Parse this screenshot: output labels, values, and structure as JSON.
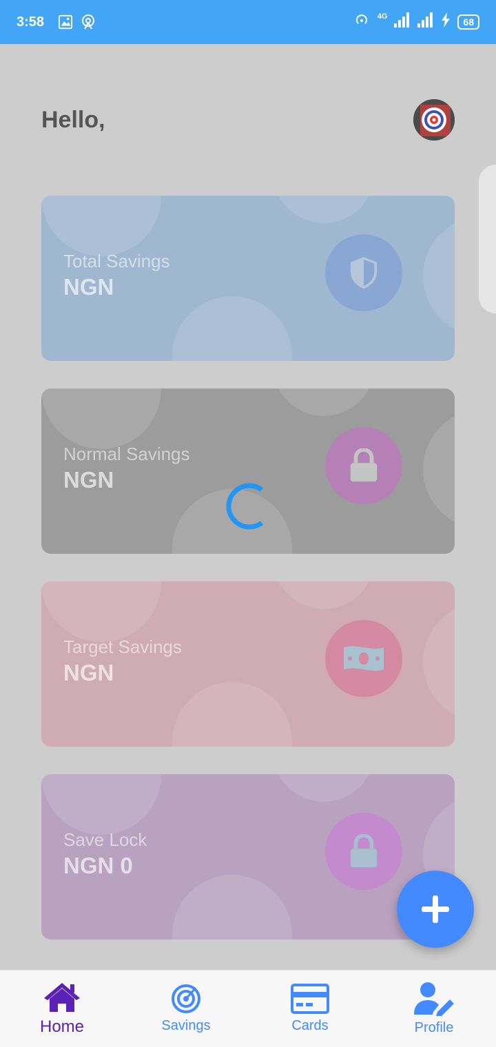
{
  "status_bar": {
    "time": "3:58",
    "network": "4G",
    "battery": "68"
  },
  "header": {
    "greeting": "Hello,"
  },
  "cards": [
    {
      "label": "Total Savings",
      "amount": "NGN",
      "bg": "#a0b8cf",
      "circle": "#8aa7d4",
      "icon": "shield-icon"
    },
    {
      "label": "Normal Savings",
      "amount": "NGN",
      "bg": "#9c9c9c",
      "circle": "#b580b5",
      "icon": "lock-icon"
    },
    {
      "label": "Target Savings",
      "amount": "NGN",
      "bg": "#cfabb6",
      "circle": "#d48aa2",
      "icon": "money-icon"
    },
    {
      "label": "Save Lock",
      "amount": "NGN 0",
      "bg": "#b8a2c0",
      "circle": "#c38ace",
      "icon": "lock-icon"
    }
  ],
  "fab": {
    "icon": "plus-icon",
    "color": "#448aff"
  },
  "nav": [
    {
      "label": "Home",
      "icon": "home-icon",
      "active": true
    },
    {
      "label": "Savings",
      "icon": "savings-target-icon"
    },
    {
      "label": "Cards",
      "icon": "credit-card-icon"
    },
    {
      "label": "Profile",
      "icon": "user-edit-icon"
    }
  ]
}
